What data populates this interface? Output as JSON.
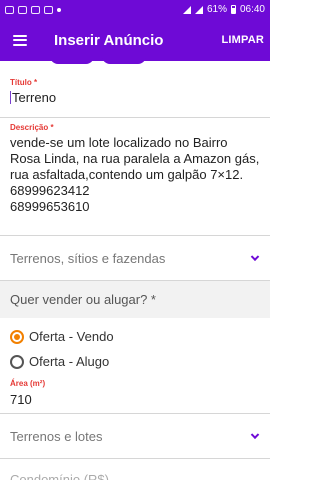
{
  "statusbar": {
    "battery_text": "61%",
    "time": "06:40",
    "icons_left": [
      "notification-icon",
      "notification-icon",
      "notification-icon",
      "notification-icon"
    ],
    "icons_right": [
      "wifi-icon",
      "signal-icon",
      "battery-icon"
    ]
  },
  "appbar": {
    "title": "Inserir Anúncio",
    "action": "LIMPAR",
    "background": "#6e0ad6"
  },
  "form": {
    "title_label": "Título *",
    "title_value": "Terreno",
    "description_label": "Descrição *",
    "description_value": "vende-se um lote localizado no Bairro Rosa Linda, na rua paralela a Amazon gás, rua asfaltada,contendo um galpão 7×12.\n68999623412\n68999653610",
    "category_value": "Terrenos, sítios e fazendas",
    "sell_question": "Quer vender ou alugar? *",
    "options": [
      {
        "label": "Oferta - Vendo",
        "checked": true
      },
      {
        "label": "Oferta - Alugo",
        "checked": false
      }
    ],
    "area_label": "Área (m²)",
    "area_value": "710",
    "subcategory_value": "Terrenos e lotes",
    "condo_label": "Condomínio (R$)"
  },
  "colors": {
    "accent": "#6e0ad6",
    "label_red": "#e53935",
    "radio_orange": "#f28000"
  }
}
